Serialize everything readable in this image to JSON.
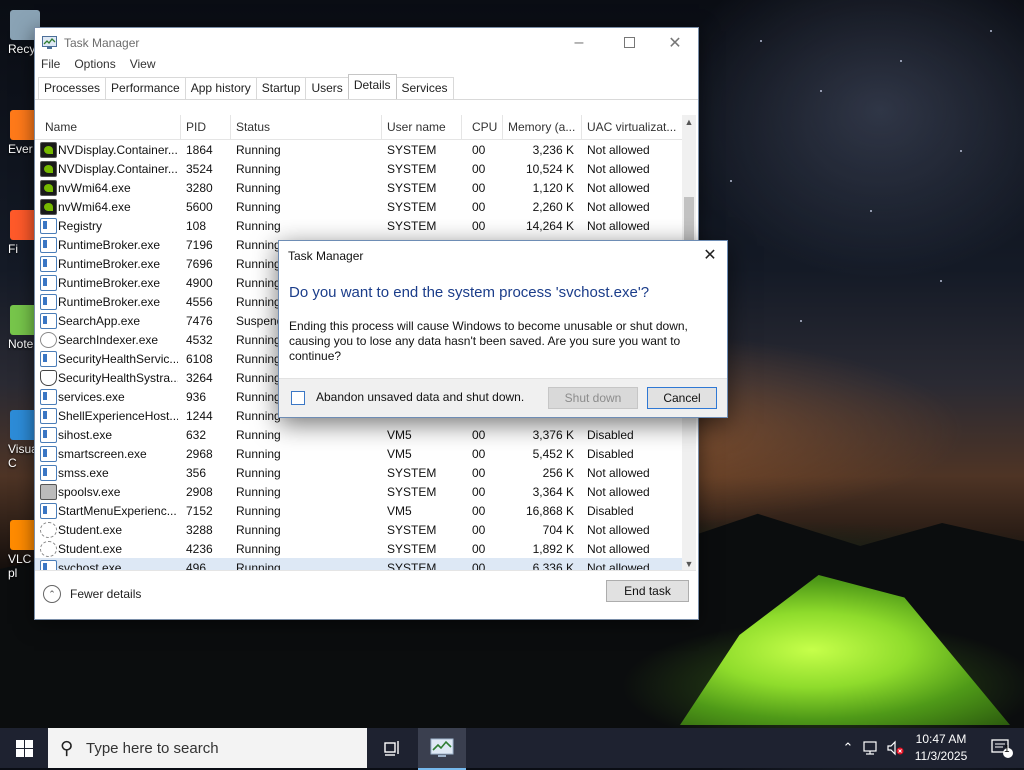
{
  "desktop": {
    "icons": [
      {
        "label": "Recy",
        "color": "#8aa3b5"
      },
      {
        "label": "Ever",
        "color": "#ff7a1a"
      },
      {
        "label": "Fi",
        "color": "#ff5a2a"
      },
      {
        "label": "Note",
        "color": "#77c64b"
      },
      {
        "label": "Visua\nC",
        "color": "#2d8cd8"
      },
      {
        "label": "VLC\npl",
        "color": "#ff8b00"
      }
    ]
  },
  "window": {
    "title": "Task Manager",
    "menu": [
      "File",
      "Options",
      "View"
    ],
    "tabs": [
      "Processes",
      "Performance",
      "App history",
      "Startup",
      "Users",
      "Details",
      "Services"
    ],
    "active_tab": "Details",
    "columns": [
      "Name",
      "PID",
      "Status",
      "User name",
      "CPU",
      "Memory (a...",
      "UAC virtualizat..."
    ],
    "rows": [
      {
        "icon": "nvidia",
        "name": "NVDisplay.Container...",
        "pid": "1864",
        "status": "Running",
        "user": "SYSTEM",
        "cpu": "00",
        "mem": "3,236 K",
        "uac": "Not allowed"
      },
      {
        "icon": "nvidia",
        "name": "NVDisplay.Container...",
        "pid": "3524",
        "status": "Running",
        "user": "SYSTEM",
        "cpu": "00",
        "mem": "10,524 K",
        "uac": "Not allowed"
      },
      {
        "icon": "nvidia",
        "name": "nvWmi64.exe",
        "pid": "3280",
        "status": "Running",
        "user": "SYSTEM",
        "cpu": "00",
        "mem": "1,120 K",
        "uac": "Not allowed"
      },
      {
        "icon": "nvidia",
        "name": "nvWmi64.exe",
        "pid": "5600",
        "status": "Running",
        "user": "SYSTEM",
        "cpu": "00",
        "mem": "2,260 K",
        "uac": "Not allowed"
      },
      {
        "icon": "window",
        "name": "Registry",
        "pid": "108",
        "status": "Running",
        "user": "SYSTEM",
        "cpu": "00",
        "mem": "14,264 K",
        "uac": "Not allowed"
      },
      {
        "icon": "window",
        "name": "RuntimeBroker.exe",
        "pid": "7196",
        "status": "Running",
        "user": "VM5",
        "cpu": "00",
        "mem": "",
        "uac": "Disabled"
      },
      {
        "icon": "window",
        "name": "RuntimeBroker.exe",
        "pid": "7696",
        "status": "Running",
        "user": "",
        "cpu": "",
        "mem": "",
        "uac": ""
      },
      {
        "icon": "window",
        "name": "RuntimeBroker.exe",
        "pid": "4900",
        "status": "Running",
        "user": "",
        "cpu": "",
        "mem": "",
        "uac": ""
      },
      {
        "icon": "window",
        "name": "RuntimeBroker.exe",
        "pid": "4556",
        "status": "Running",
        "user": "",
        "cpu": "",
        "mem": "",
        "uac": ""
      },
      {
        "icon": "window",
        "name": "SearchApp.exe",
        "pid": "7476",
        "status": "Suspend",
        "user": "",
        "cpu": "",
        "mem": "",
        "uac": ""
      },
      {
        "icon": "search",
        "name": "SearchIndexer.exe",
        "pid": "4532",
        "status": "Running",
        "user": "",
        "cpu": "",
        "mem": "",
        "uac": ""
      },
      {
        "icon": "window",
        "name": "SecurityHealthServic...",
        "pid": "6108",
        "status": "Running",
        "user": "",
        "cpu": "",
        "mem": "",
        "uac": ""
      },
      {
        "icon": "shield",
        "name": "SecurityHealthSystra...",
        "pid": "3264",
        "status": "Running",
        "user": "",
        "cpu": "",
        "mem": "",
        "uac": ""
      },
      {
        "icon": "window",
        "name": "services.exe",
        "pid": "936",
        "status": "Running",
        "user": "",
        "cpu": "",
        "mem": "",
        "uac": ""
      },
      {
        "icon": "window",
        "name": "ShellExperienceHost....",
        "pid": "1244",
        "status": "Running",
        "user": "",
        "cpu": "",
        "mem": "",
        "uac": ""
      },
      {
        "icon": "window",
        "name": "sihost.exe",
        "pid": "632",
        "status": "Running",
        "user": "VM5",
        "cpu": "00",
        "mem": "3,376 K",
        "uac": "Disabled"
      },
      {
        "icon": "window",
        "name": "smartscreen.exe",
        "pid": "2968",
        "status": "Running",
        "user": "VM5",
        "cpu": "00",
        "mem": "5,452 K",
        "uac": "Disabled"
      },
      {
        "icon": "window",
        "name": "smss.exe",
        "pid": "356",
        "status": "Running",
        "user": "SYSTEM",
        "cpu": "00",
        "mem": "256 K",
        "uac": "Not allowed"
      },
      {
        "icon": "printer",
        "name": "spoolsv.exe",
        "pid": "2908",
        "status": "Running",
        "user": "SYSTEM",
        "cpu": "00",
        "mem": "3,364 K",
        "uac": "Not allowed"
      },
      {
        "icon": "window",
        "name": "StartMenuExperienc...",
        "pid": "7152",
        "status": "Running",
        "user": "VM5",
        "cpu": "00",
        "mem": "16,868 K",
        "uac": "Disabled"
      },
      {
        "icon": "gear",
        "name": "Student.exe",
        "pid": "3288",
        "status": "Running",
        "user": "SYSTEM",
        "cpu": "00",
        "mem": "704 K",
        "uac": "Not allowed"
      },
      {
        "icon": "gear",
        "name": "Student.exe",
        "pid": "4236",
        "status": "Running",
        "user": "SYSTEM",
        "cpu": "00",
        "mem": "1,892 K",
        "uac": "Not allowed"
      },
      {
        "icon": "window",
        "name": "svchost.exe",
        "pid": "496",
        "status": "Running",
        "user": "SYSTEM",
        "cpu": "00",
        "mem": "6,336 K",
        "uac": "Not allowed",
        "selected": true
      }
    ],
    "fewer_details": "Fewer details",
    "end_task": "End task"
  },
  "dialog": {
    "title": "Task Manager",
    "heading": "Do you want to end the system process 'svchost.exe'?",
    "body": "Ending this process will cause Windows to become unusable or shut down, causing you to lose any data hasn't been saved. Are you sure you want to continue?",
    "checkbox_label": "Abandon unsaved data and shut down.",
    "checkbox_checked": false,
    "shutdown_label": "Shut down",
    "cancel_label": "Cancel"
  },
  "taskbar": {
    "search_placeholder": "Type here to search",
    "time": "10:47 AM",
    "date": "11/3/2025",
    "notification_count": "1"
  },
  "colors": {
    "accent": "#1b3d8a",
    "selection": "#dde8f5",
    "taskbar": "#1e2230"
  }
}
